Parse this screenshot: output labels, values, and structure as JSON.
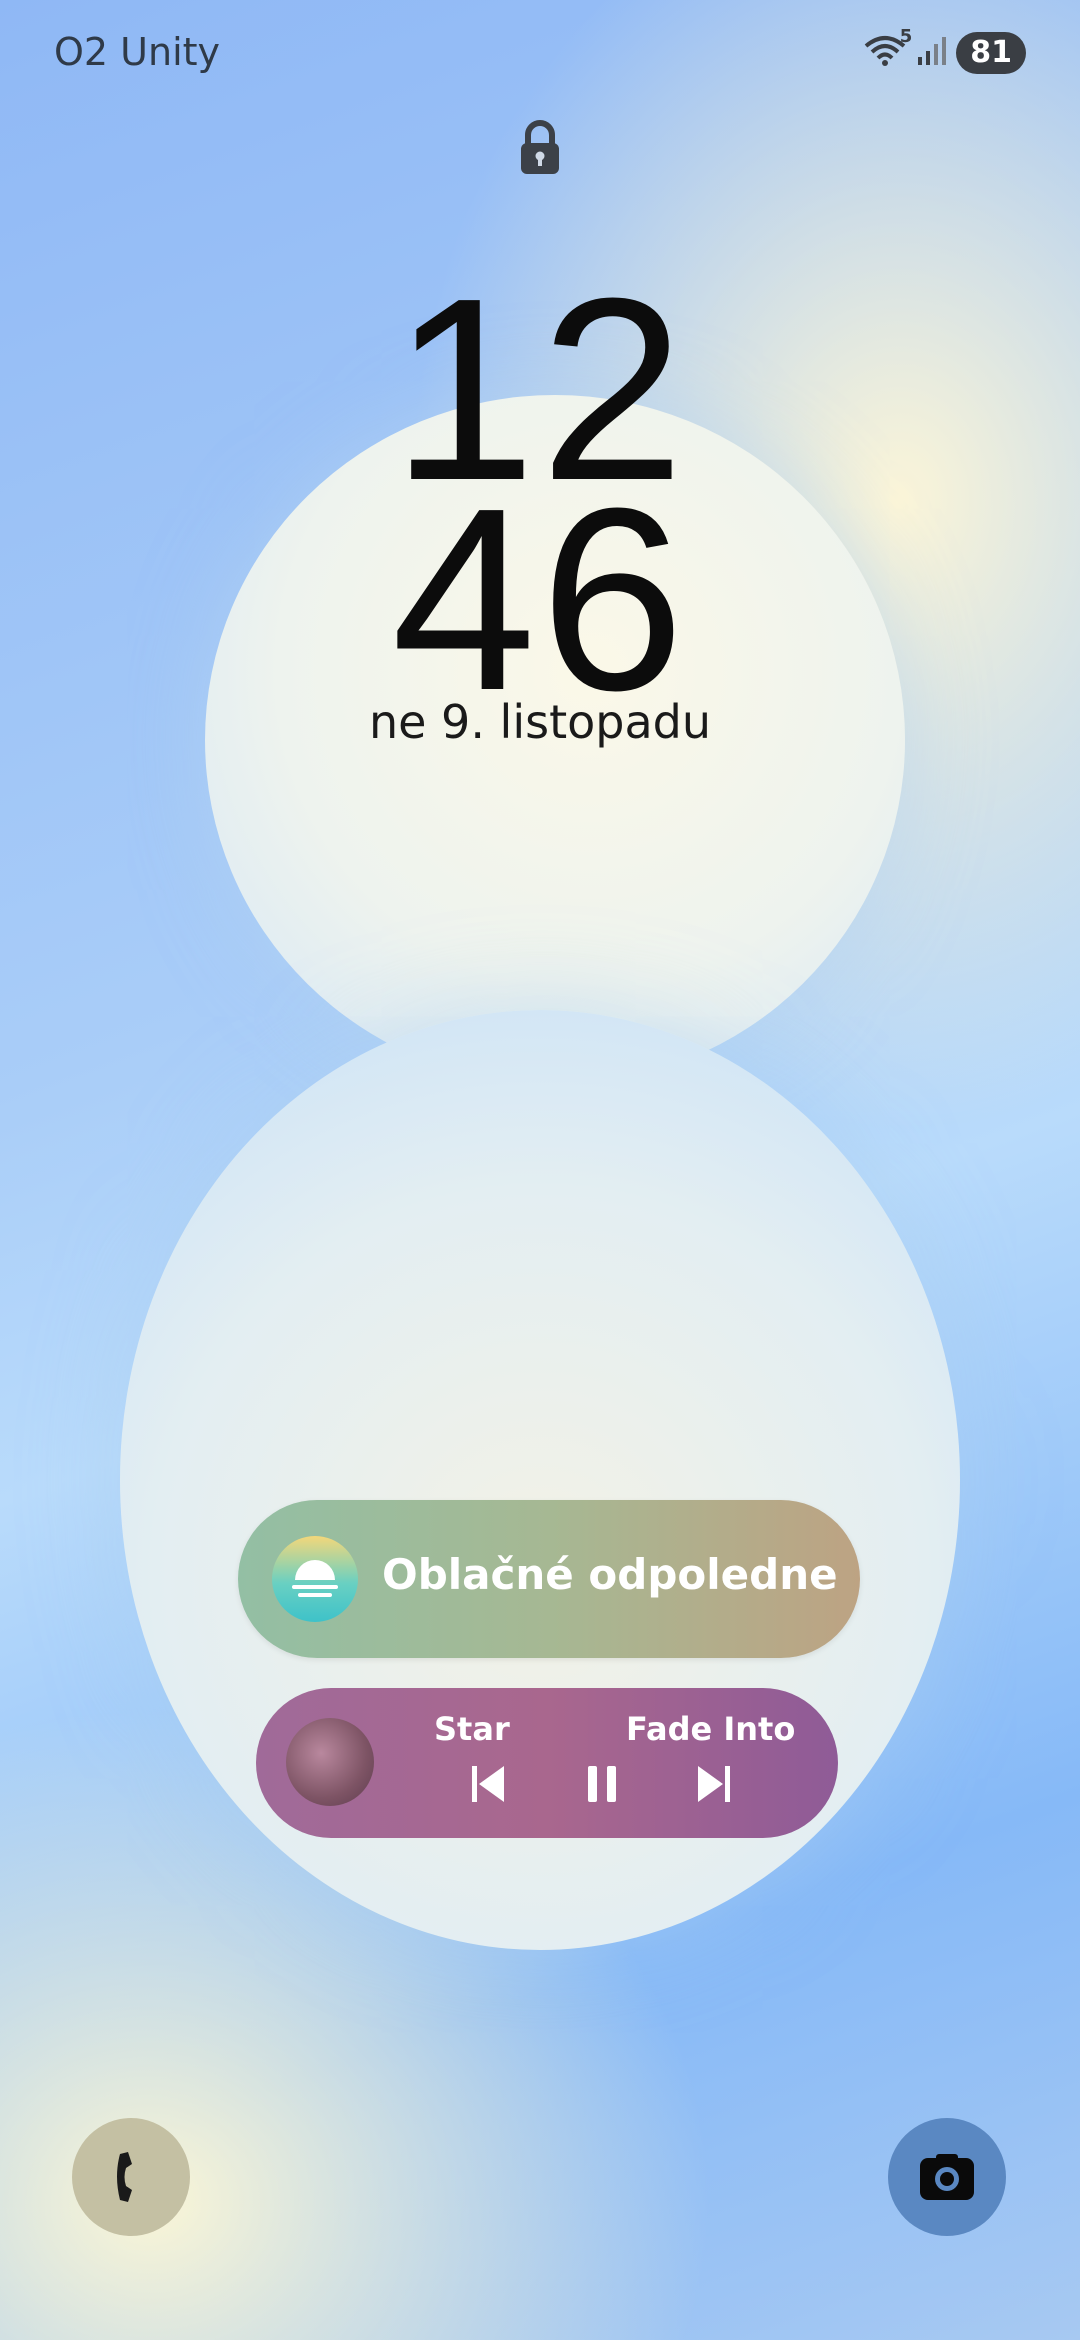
{
  "status_bar": {
    "carrier": "O2 Unity",
    "battery": "81",
    "network_label": "5",
    "icons": [
      "wifi-icon",
      "signal-icon",
      "battery-icon"
    ]
  },
  "lock_icon": "lock-icon",
  "clock": {
    "hour": "12",
    "minute": "46"
  },
  "date": "ne 9. listopadu",
  "weather": {
    "text": "Oblačné odpoledne",
    "icon": "cloudy-icon"
  },
  "music": {
    "track_left": "Star",
    "track_right": "Fade Into",
    "controls": [
      "previous-icon",
      "pause-icon",
      "next-icon"
    ]
  },
  "shortcuts": {
    "left": "phone-icon",
    "right": "camera-icon"
  },
  "colors": {
    "weather_pill_start": "#93bfa4",
    "weather_pill_end": "#bda383",
    "music_pill": "#a06a99",
    "clock": "#0c0c0c"
  }
}
